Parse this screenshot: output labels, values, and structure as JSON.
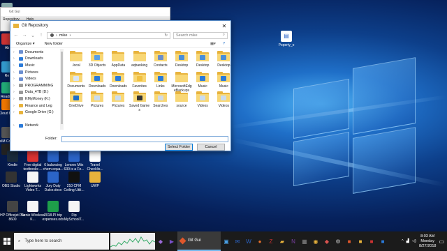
{
  "desktop": {
    "left_icons": [
      {
        "label": "Recy",
        "color": "#8aa"
      },
      {
        "label": "Ab",
        "color": "#c33"
      },
      {
        "label": "Re",
        "color": "#39c"
      },
      {
        "label": "ReadiW",
        "color": "#2a7"
      },
      {
        "label": "Cloud\nBac",
        "color": "#e70"
      },
      {
        "label": "FeelM\nCommu",
        "color": "#555"
      },
      {
        "label": "",
        "color": "#222"
      }
    ],
    "row1": [
      {
        "label": "Kindle",
        "color": "#1a2b3c"
      },
      {
        "label": "Free digital textbooks ...",
        "color": "#d33"
      },
      {
        "label": "6 balancing chem equa...",
        "color": "#2b64c7"
      },
      {
        "label": "Lenovo Miix 630 is a Fe...",
        "color": "#2b64c7"
      },
      {
        "label": "Travel Checklis...",
        "color": "#fff"
      }
    ],
    "row2": [
      {
        "label": "OBS Studio",
        "color": "#333"
      },
      {
        "label": "Lightworks Video T...",
        "color": "#f5f5f5"
      },
      {
        "label": "Jury Duty Dulce.docx",
        "color": "#2b64c7"
      },
      {
        "label": "210 CFM Ceiling Utili...",
        "color": "#111"
      },
      {
        "label": "UWP",
        "color": "#e8b33c"
      }
    ],
    "row3": [
      {
        "label": "HP Officejet Pro 8600",
        "color": "#444"
      },
      {
        "label": "Genie Wireless K...",
        "color": "#f5f5f5"
      },
      {
        "label": "2018-PI trip expenses.ods",
        "color": "#1e9e4a"
      },
      {
        "label": "Ftp MySchoolT...",
        "color": "#f5f5f5"
      }
    ],
    "right_icon": {
      "label": "Poperty_o",
      "color": "#fff"
    }
  },
  "gitgui_window": {
    "title": "Git Gui",
    "menu": [
      "Repository",
      "Help"
    ]
  },
  "dialog": {
    "title": "Git Repository",
    "close": "✕",
    "address": {
      "parts": [
        "›",
        "mike",
        "›"
      ]
    },
    "search_placeholder": "Search mike",
    "commands": {
      "organize": "Organize ▾",
      "new_folder": "New folder"
    },
    "nav_tree": [
      {
        "label": "Documents",
        "color": "#6b8fd1"
      },
      {
        "label": "Downloads",
        "color": "#2a7ad9"
      },
      {
        "label": "Music",
        "color": "#2a7ad9"
      },
      {
        "label": "Pictures",
        "color": "#6b8fd1"
      },
      {
        "label": "Videos",
        "color": "#6b8fd1"
      },
      {
        "label": "PROGRAMMING",
        "color": "#999"
      },
      {
        "label": "Data_4TB (D:)",
        "color": "#999"
      },
      {
        "label": "KMyMoney (K:)",
        "color": "#999"
      },
      {
        "label": "Finance and Leg",
        "color": "#e8b33c"
      },
      {
        "label": "Google Drive (G:)",
        "color": "#e8b33c"
      },
      {
        "label": "",
        "color": "#fff"
      },
      {
        "label": "Network",
        "color": "#2a7ad9"
      }
    ],
    "items": [
      {
        "label": ".local",
        "badge": ""
      },
      {
        "label": "3D Objects",
        "badge": "#5aa0e6"
      },
      {
        "label": "AppData",
        "badge": ""
      },
      {
        "label": "aqbanking",
        "badge": ""
      },
      {
        "label": "Contacts",
        "badge": "#6c8ec9"
      },
      {
        "label": "Desktop",
        "badge": "#4a8fd9"
      },
      {
        "label": "Desktop",
        "badge": "#4a8fd9"
      },
      {
        "label": "Desktop",
        "badge": "#4a8fd9"
      },
      {
        "label": "Documents",
        "badge": "#d9e6f5"
      },
      {
        "label": "Downloads",
        "badge": "#2a7ad9"
      },
      {
        "label": "Downloads",
        "badge": "#2a7ad9"
      },
      {
        "label": "Favorites",
        "badge": "#f0c040"
      },
      {
        "label": "Links",
        "badge": "#2a7ad9"
      },
      {
        "label": "MicrosoftEdgeBackups",
        "badge": ""
      },
      {
        "label": "Music",
        "badge": "#2a7ad9"
      },
      {
        "label": "Music",
        "badge": "#2a7ad9"
      },
      {
        "label": "OneDrive",
        "badge": "#1f6fc8"
      },
      {
        "label": "Pictures",
        "badge": "#c9dcef"
      },
      {
        "label": "Pictures",
        "badge": "#c9dcef"
      },
      {
        "label": "Saved Games",
        "badge": "#333"
      },
      {
        "label": "Searches",
        "badge": "#cfd9e6"
      },
      {
        "label": "source",
        "badge": ""
      },
      {
        "label": "Videos",
        "badge": "#c9dcef"
      },
      {
        "label": "Videos",
        "badge": "#c9dcef"
      }
    ],
    "folder_label": "Folder:",
    "folder_value": "",
    "select_button": "Select Folder",
    "cancel_button": "Cancel"
  },
  "taskbar": {
    "search_text": "Type here to search",
    "git_label": "Git Gui",
    "time": "8:03 AM",
    "day": "Monday",
    "date": "8/27/2018"
  }
}
